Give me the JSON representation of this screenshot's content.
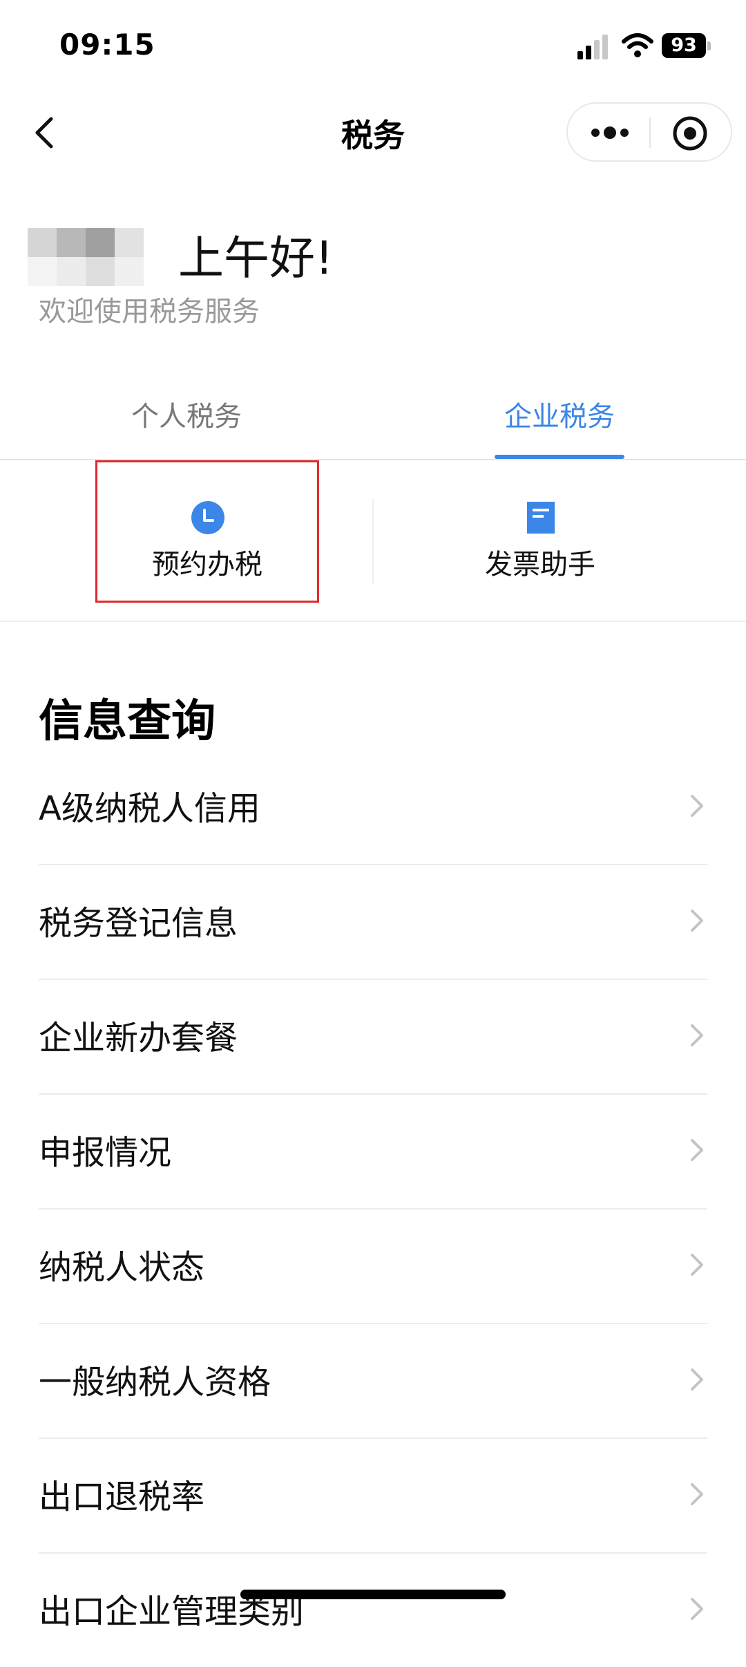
{
  "status_bar": {
    "time": "09:15",
    "battery": "93",
    "icons": [
      "signal-icon",
      "wifi-icon",
      "battery-icon"
    ]
  },
  "nav": {
    "title": "税务",
    "icons": [
      "back-icon",
      "more-icon",
      "close-circle-icon"
    ]
  },
  "greeting": {
    "title": "上午好!",
    "subtitle": "欢迎使用税务服务"
  },
  "tabs": [
    {
      "label": "个人税务",
      "active": false
    },
    {
      "label": "企业税务",
      "active": true
    }
  ],
  "quick_actions": [
    {
      "label": "预约办税",
      "icon": "clock-icon"
    },
    {
      "label": "发票助手",
      "icon": "document-icon"
    }
  ],
  "section": {
    "title": "信息查询",
    "items": [
      {
        "label": "A级纳税人信用"
      },
      {
        "label": "税务登记信息"
      },
      {
        "label": "企业新办套餐"
      },
      {
        "label": "申报情况"
      },
      {
        "label": "纳税人状态"
      },
      {
        "label": "一般纳税人资格"
      },
      {
        "label": "出口退税率"
      },
      {
        "label": "出口企业管理类别"
      }
    ]
  },
  "colors": {
    "accent": "#3b86e6",
    "highlight": "#e0292b",
    "secondary_text": "#999999"
  }
}
